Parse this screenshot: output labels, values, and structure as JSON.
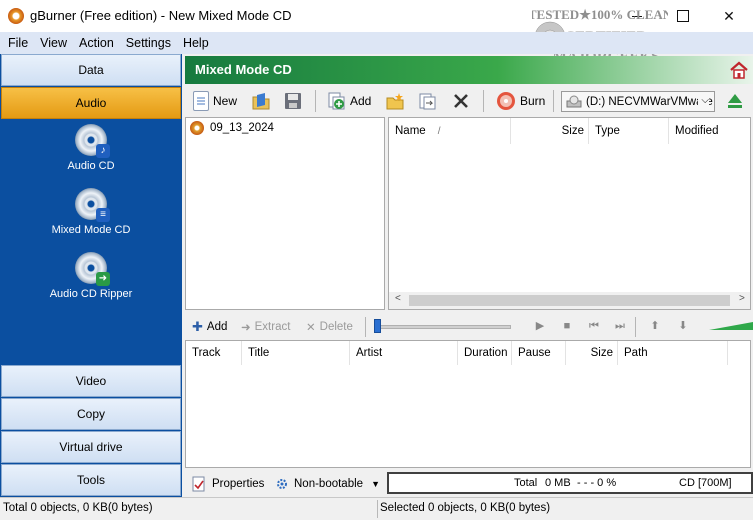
{
  "window": {
    "title": "gBurner (Free edition) - New Mixed Mode CD",
    "minimize_glyph": "",
    "maximize_glyph": "",
    "close_glyph": "✕"
  },
  "watermark": {
    "line1": "TESTED★100% CLEAN",
    "line2": "CERTIFIED",
    "line3": "MAJORGEEKS",
    "line4": "★★★★★★ .COM"
  },
  "menu": [
    "File",
    "View",
    "Action",
    "Settings",
    "Help"
  ],
  "categories": {
    "data": "Data",
    "audio": "Audio",
    "video": "Video",
    "copy": "Copy",
    "virtual_drive": "Virtual drive",
    "tools": "Tools"
  },
  "audio_items": [
    {
      "label": "Audio CD",
      "icon": "audio-cd-icon"
    },
    {
      "label": "Mixed Mode CD",
      "icon": "mixed-mode-cd-icon"
    },
    {
      "label": "Audio CD Ripper",
      "icon": "audio-cd-ripper-icon"
    }
  ],
  "header": {
    "title": "Mixed Mode CD"
  },
  "toolbar": {
    "new_label": "New",
    "add_label": "Add",
    "burn_label": "Burn",
    "drive": "(D:) NECVMWarVMware SATA CD00",
    "drive_chevron": "⌵"
  },
  "tree": {
    "root": "09_13_2024"
  },
  "file_columns": [
    "Name",
    "/",
    "Size",
    "Type",
    "Modified"
  ],
  "scroll_glyphs": {
    "left": "<",
    "right": ">"
  },
  "track_toolbar": {
    "add": "Add",
    "extract": "Extract",
    "delete": "Delete",
    "add_glyph": "✚",
    "extract_glyph": "➜",
    "delete_glyph": "✕",
    "play_glyph": "▶",
    "stop_glyph": "■",
    "prev_glyph": "⏮",
    "next_glyph": "⏭",
    "up_glyph": "⬆",
    "down_glyph": "⬇"
  },
  "track_columns": [
    "Track",
    "Title",
    "Artist",
    "Duration",
    "Pause",
    "Size",
    "Path"
  ],
  "bottom": {
    "properties": "Properties",
    "boot": "Non-bootable",
    "boot_chevron": "▼",
    "total_label": "Total",
    "total_value": "0 MB",
    "progress": "- - - 0 %",
    "media": "CD [700M]"
  },
  "status": {
    "left": "Total 0 objects, 0 KB(0 bytes)",
    "right": "Selected 0 objects, 0 KB(0 bytes)"
  },
  "colors": {
    "left_panel": "#0b4fa0",
    "active_category": "#f0ac28",
    "header_green": "#167a3f"
  }
}
